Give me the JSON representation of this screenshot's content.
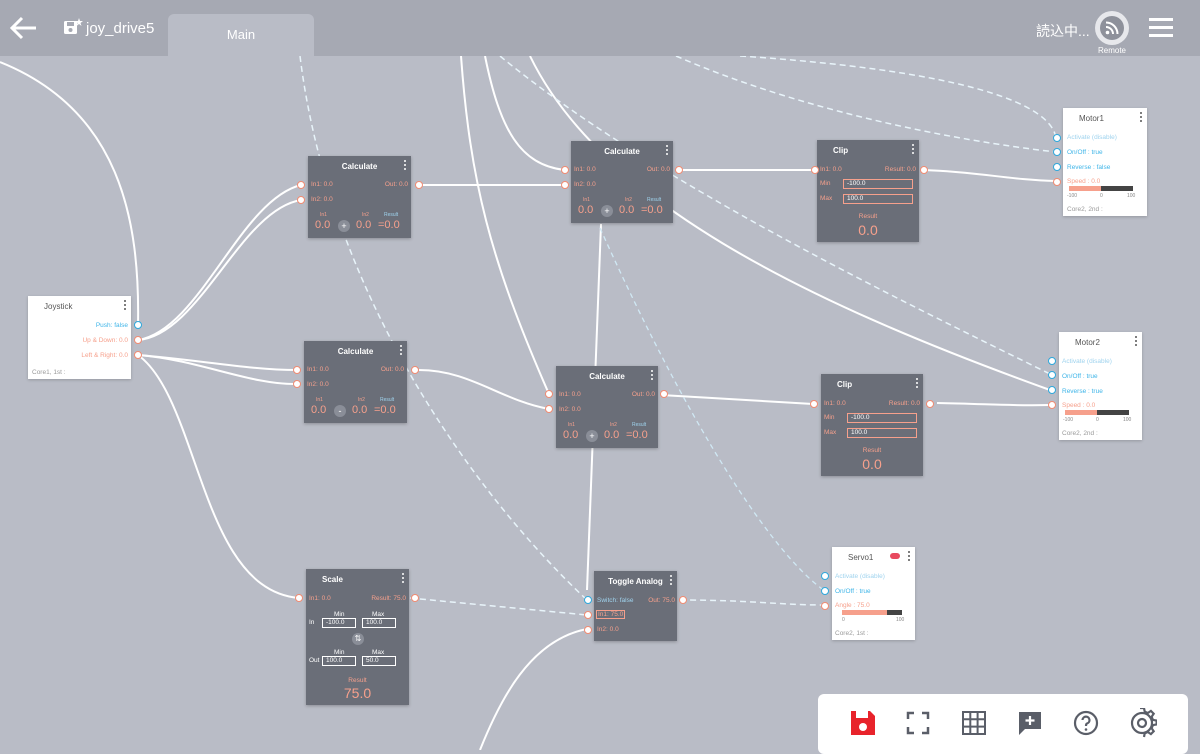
{
  "header": {
    "project_name": "joy_drive5",
    "tab_main": "Main",
    "status": "読込中...",
    "remote_label": "Remote"
  },
  "icons": {
    "back": "arrow-left-icon",
    "project": "save-file-icon",
    "remote": "wifi-signal-icon",
    "menu": "hamburger-menu-icon"
  },
  "colors": {
    "background": "#b9bcc6",
    "node_dark": "#6a6e78",
    "accent_salmon": "#f6a08c",
    "accent_blue": "#2ea8dc",
    "save_red": "#e8232b"
  },
  "joystick": {
    "title": "Joystick",
    "push": "Push: false",
    "updown": "Up & Down: 0.0",
    "leftright": "Left & Right: 0.0",
    "core": "Core1, 1st :"
  },
  "calc1": {
    "title": "Calculate",
    "in1": "In1: 0.0",
    "in2": "In2: 0.0",
    "out": "Out: 0.0",
    "in1_h": "In1",
    "in2_h": "In2",
    "res_h": "Result",
    "v1": "0.0",
    "op": "+",
    "v2": "0.0",
    "res": "=0.0"
  },
  "calc2": {
    "title": "Calculate",
    "in1": "In1: 0.0",
    "in2": "In2: 0.0",
    "out": "Out: 0.0",
    "in1_h": "In1",
    "in2_h": "In2",
    "res_h": "Result",
    "v1": "0.0",
    "op": "-",
    "v2": "0.0",
    "res": "=0.0"
  },
  "calc3": {
    "title": "Calculate",
    "in1": "In1: 0.0",
    "in2": "In2: 0.0",
    "out": "Out: 0.0",
    "in1_h": "In1",
    "in2_h": "In2",
    "res_h": "Result",
    "v1": "0.0",
    "op": "+",
    "v2": "0.0",
    "res": "=0.0"
  },
  "calc4": {
    "title": "Calculate",
    "in1": "In1: 0.0",
    "in2": "In2: 0.0",
    "out": "Out: 0.0",
    "in1_h": "In1",
    "in2_h": "In2",
    "res_h": "Result",
    "v1": "0.0",
    "op": "+",
    "v2": "0.0",
    "res": "=0.0"
  },
  "clip1": {
    "title": "Clip",
    "in1": "In1: 0.0",
    "result_port": "Result: 0.0",
    "min_label": "Min",
    "min": "-100.0",
    "max_label": "Max",
    "max": "100.0",
    "res_label": "Result",
    "res": "0.0"
  },
  "clip2": {
    "title": "Clip",
    "in1": "In1: 0.0",
    "result_port": "Result: 0.0",
    "min_label": "Min",
    "min": "-100.0",
    "max_label": "Max",
    "max": "100.0",
    "res_label": "Result",
    "res": "0.0"
  },
  "scale": {
    "title": "Scale",
    "in1": "In1: 0.0",
    "result_port": "Result: 75.0",
    "min_h": "Min",
    "max_h": "Max",
    "in_label": "In",
    "in_min": "-100.0",
    "in_max": "100.0",
    "out_label": "Out",
    "out_min": "100.0",
    "out_max": "50.0",
    "res_label": "Result",
    "res": "75.0"
  },
  "toggle": {
    "title": "Toggle Analog",
    "switch": "Switch: false",
    "out": "Out: 75.0",
    "in1": "In1: 75.0",
    "in2": "In2: 0.0"
  },
  "motor1": {
    "title": "Motor1",
    "activate": "Activate (disable)",
    "onoff": "On/Off : true",
    "reverse": "Reverse : false",
    "speed": "Speed : 0.0",
    "tick_min": "-100",
    "tick_mid": "0",
    "tick_max": "100",
    "speed_fraction": 0.5,
    "core": "Core2, 2nd :"
  },
  "motor2": {
    "title": "Motor2",
    "activate": "Activate (disable)",
    "onoff": "On/Off : true",
    "reverse": "Reverse : true",
    "speed": "Speed : 0.0",
    "tick_min": "-100",
    "tick_mid": "0",
    "tick_max": "100",
    "speed_fraction": 0.5,
    "core": "Core2, 2nd :"
  },
  "servo1": {
    "title": "Servo1",
    "activate": "Activate (disable)",
    "onoff": "On/Off : true",
    "angle": "Angle : 75.0",
    "tick_min": "0",
    "tick_max": "100",
    "angle_fraction": 0.75,
    "core": "Core2, 1st :"
  },
  "toolbar": {
    "icons": [
      "save-icon",
      "fullscreen-icon",
      "grid-icon",
      "add-comment-icon",
      "help-icon",
      "settings-icon"
    ]
  }
}
